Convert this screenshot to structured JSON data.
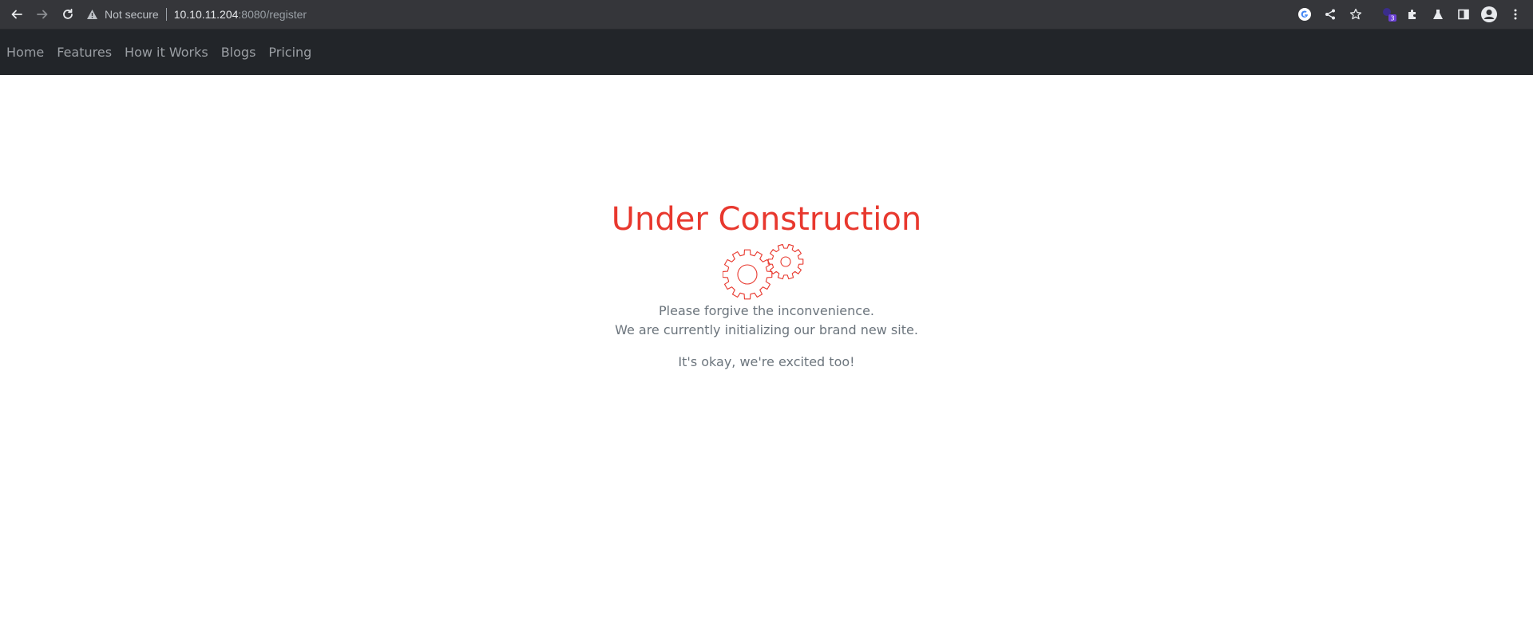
{
  "browser": {
    "security_label": "Not secure",
    "url_host": "10.10.11.204",
    "url_rest": ":8080/register",
    "extension_badge": "3"
  },
  "navbar": {
    "items": [
      {
        "label": "Home"
      },
      {
        "label": "Features"
      },
      {
        "label": "How it Works"
      },
      {
        "label": "Blogs"
      },
      {
        "label": "Pricing"
      }
    ]
  },
  "main": {
    "title": "Under Construction",
    "icon": "gears-icon",
    "line1": "Please forgive the inconvenience.",
    "line2": "We are currently initializing our brand new site.",
    "line3": "It's okay, we're excited too!"
  },
  "colors": {
    "accent": "#e8382e",
    "navbar_bg": "#222529",
    "toolbar_bg": "#35363a",
    "body_text": "#6c757d"
  }
}
